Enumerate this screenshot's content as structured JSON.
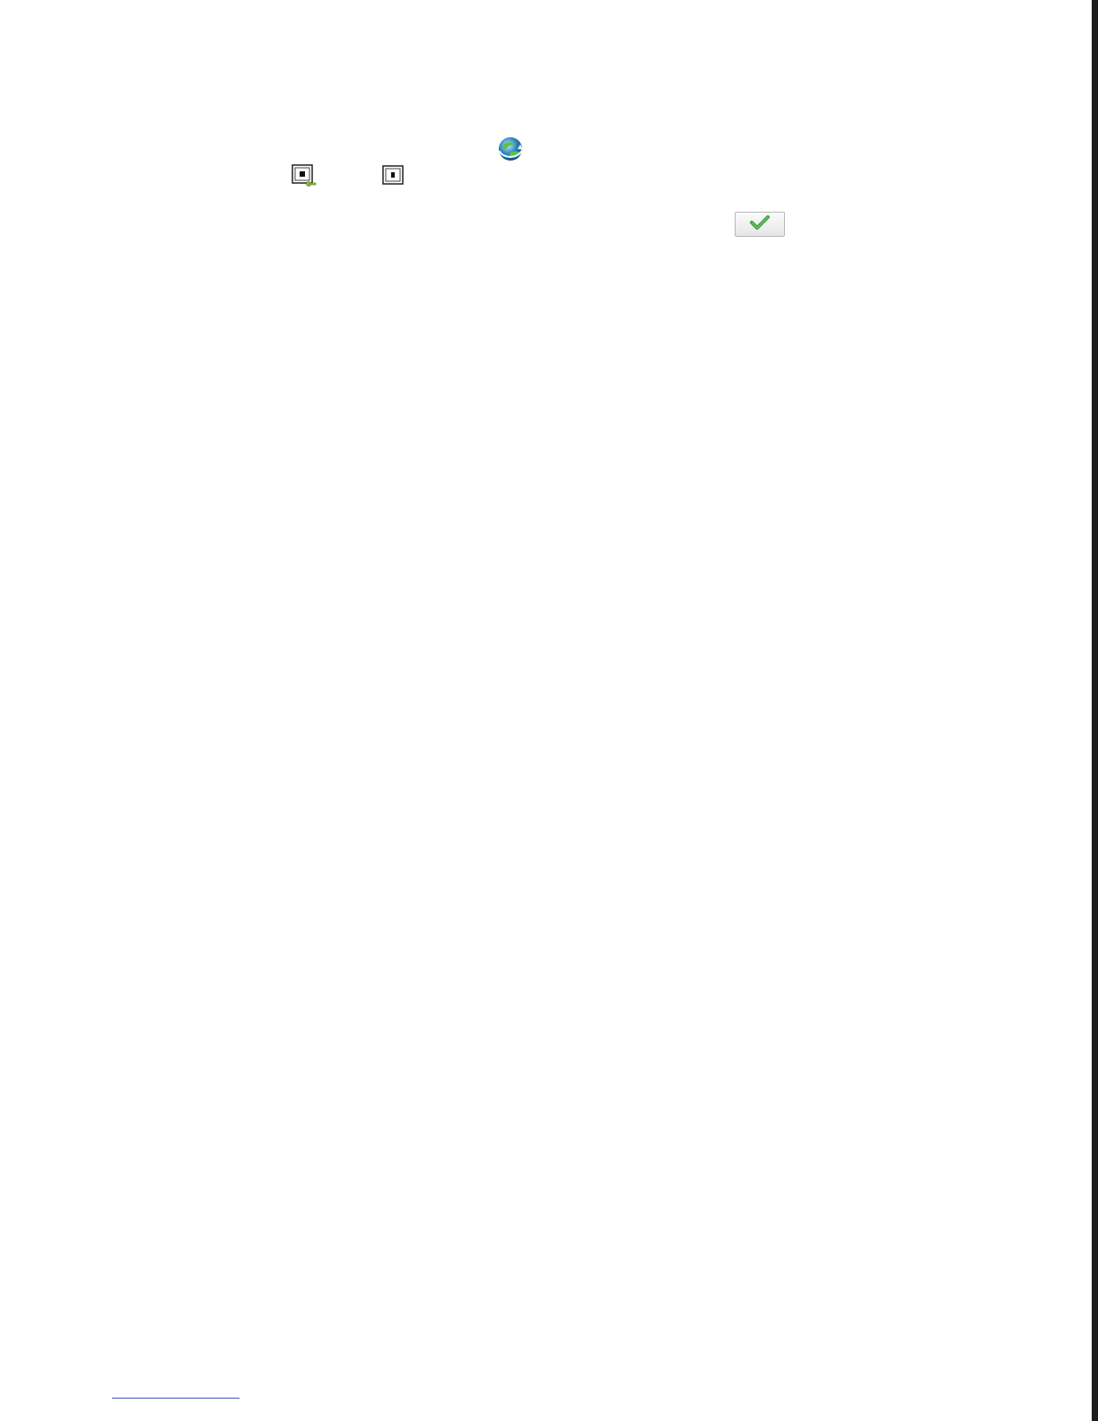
{
  "icons": {
    "globe": "globe-refresh-icon",
    "window_a": "window-key-icon",
    "window_b": "window-icon",
    "confirm": "check-icon"
  },
  "colors": {
    "check_green": "#3aa33a",
    "globe_blue": "#2e86c1",
    "rule_blue": "#2f5cb5"
  }
}
